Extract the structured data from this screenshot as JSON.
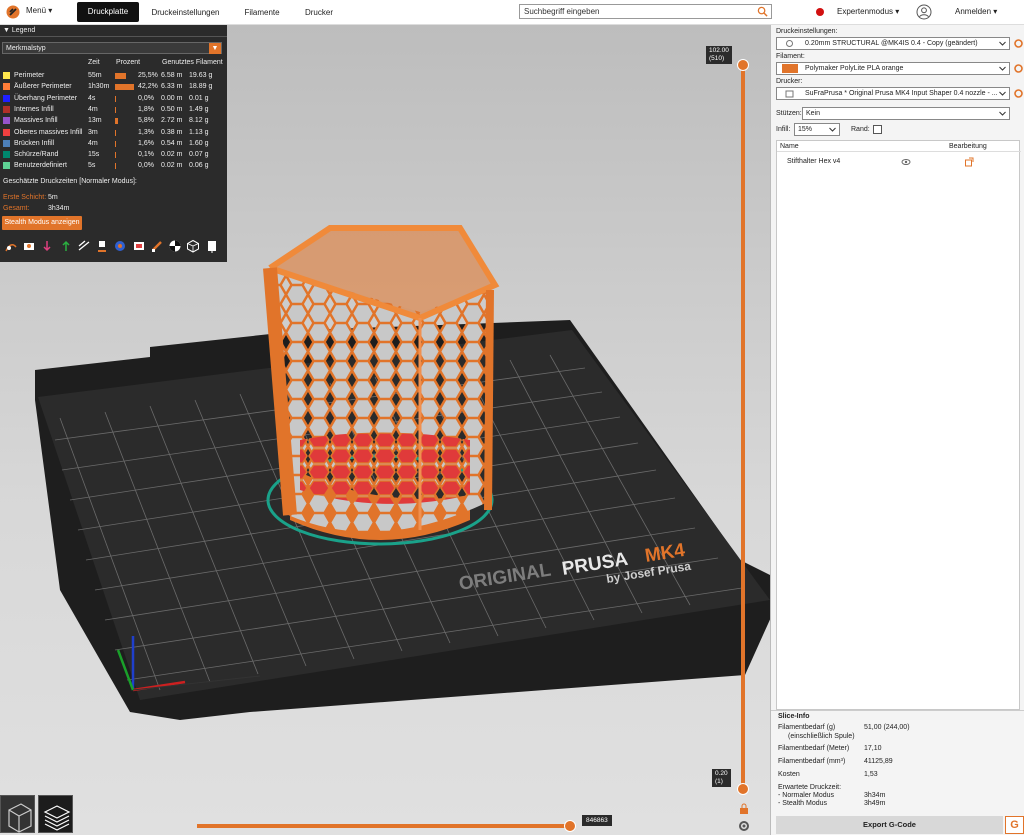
{
  "topbar": {
    "menu": "Menü",
    "tabs": [
      "Druckplatte",
      "Druckeinstellungen",
      "Filamente",
      "Drucker"
    ],
    "active_tab": "Druckplatte",
    "search_placeholder": "Suchbegriff eingeben",
    "expert_mode": "Expertenmodus",
    "login": "Anmelden"
  },
  "legend": {
    "title": "Legend",
    "view_type": "Merkmalstyp",
    "col_time": "Zeit",
    "col_percent": "Prozent",
    "col_filament": "Genutztes Filament",
    "features": [
      {
        "name": "Perimeter",
        "time": "55m",
        "percent": "25,5%",
        "meters": "6.58 m",
        "grams": "19.63 g",
        "color": "#ffe64d",
        "fraction": 0.255
      },
      {
        "name": "Äußerer Perimeter",
        "time": "1h30m",
        "percent": "42,2%",
        "meters": "6.33 m",
        "grams": "18.89 g",
        "color": "#ff7d38",
        "fraction": 0.422
      },
      {
        "name": "Überhang Perimeter",
        "time": "4s",
        "percent": "0,0%",
        "meters": "0.00 m",
        "grams": "0.01 g",
        "color": "#1f1fff",
        "fraction": 0.0
      },
      {
        "name": "Internes Infill",
        "time": "4m",
        "percent": "1,8%",
        "meters": "0.50 m",
        "grams": "1.49 g",
        "color": "#b03029",
        "fraction": 0.018
      },
      {
        "name": "Massives Infill",
        "time": "13m",
        "percent": "5,8%",
        "meters": "2.72 m",
        "grams": "8.12 g",
        "color": "#9654cc",
        "fraction": 0.058
      },
      {
        "name": "Oberes massives Infill",
        "time": "3m",
        "percent": "1,3%",
        "meters": "0.38 m",
        "grams": "1.13 g",
        "color": "#f04040",
        "fraction": 0.013
      },
      {
        "name": "Brücken Infill",
        "time": "4m",
        "percent": "1,6%",
        "meters": "0.54 m",
        "grams": "1.60 g",
        "color": "#4d80ba",
        "fraction": 0.016
      },
      {
        "name": "Schürze/Rand",
        "time": "15s",
        "percent": "0,1%",
        "meters": "0.02 m",
        "grams": "0.07 g",
        "color": "#00876e",
        "fraction": 0.001
      },
      {
        "name": "Benutzerdefiniert",
        "time": "5s",
        "percent": "0,0%",
        "meters": "0.02 m",
        "grams": "0.06 g",
        "color": "#5ed194",
        "fraction": 0.0
      }
    ],
    "estimated_times": "Geschätzte Druckzeiten [Normaler Modus]:",
    "first_layer_label": "Erste Schicht:",
    "first_layer_value": "5m",
    "total_label": "Gesamt:",
    "total_value": "3h34m",
    "stealth_button": "Stealth Modus anzeigen"
  },
  "viewport": {
    "bed_brand": "ORIGINAL",
    "bed_brand2": "PRUSA",
    "bed_model": "MK4",
    "bed_by": "by Josef Prusa",
    "top_height": "102.00",
    "top_layer": "(510)",
    "bottom_height": "0.20",
    "bottom_layer": "(1)",
    "move_count": "846863"
  },
  "right_panel": {
    "print_settings_label": "Druckeinstellungen:",
    "print_settings_value": "0.20mm STRUCTURAL @MK4IS 0.4 - Copy (geändert)",
    "filament_label": "Filament:",
    "filament_value": "Polymaker PolyLite PLA orange",
    "filament_color": "#e1742a",
    "printer_label": "Drucker:",
    "printer_value": "SuFraPrusa * Original Prusa MK4 Input Shaper 0.4 nozzle - ...",
    "supports_label": "Stützen:",
    "supports_value": "Kein",
    "infill_label": "Infill:",
    "infill_value": "15%",
    "brim_label": "Rand:",
    "col_name": "Name",
    "col_edit": "Bearbeitung",
    "object_name": "Stifthalter Hex v4"
  },
  "slice_info": {
    "title": "Slice-Info",
    "rows": [
      {
        "label": "Filamentbedarf (g)",
        "value": "51,00 (244,00)"
      },
      {
        "label": "(einschließlich Spule)",
        "value": ""
      },
      {
        "label": "Filamentbedarf (Meter)",
        "value": "17,10"
      },
      {
        "label": "Filamentbedarf (mm³)",
        "value": "41125,89"
      },
      {
        "label": "Kosten",
        "value": "1,53"
      },
      {
        "label": "Erwartete Druckzeit:",
        "value": ""
      },
      {
        "label": "- Normaler Modus",
        "value": "3h34m"
      },
      {
        "label": "- Stealth Modus",
        "value": "3h49m"
      }
    ],
    "export_button": "Export G-Code"
  }
}
